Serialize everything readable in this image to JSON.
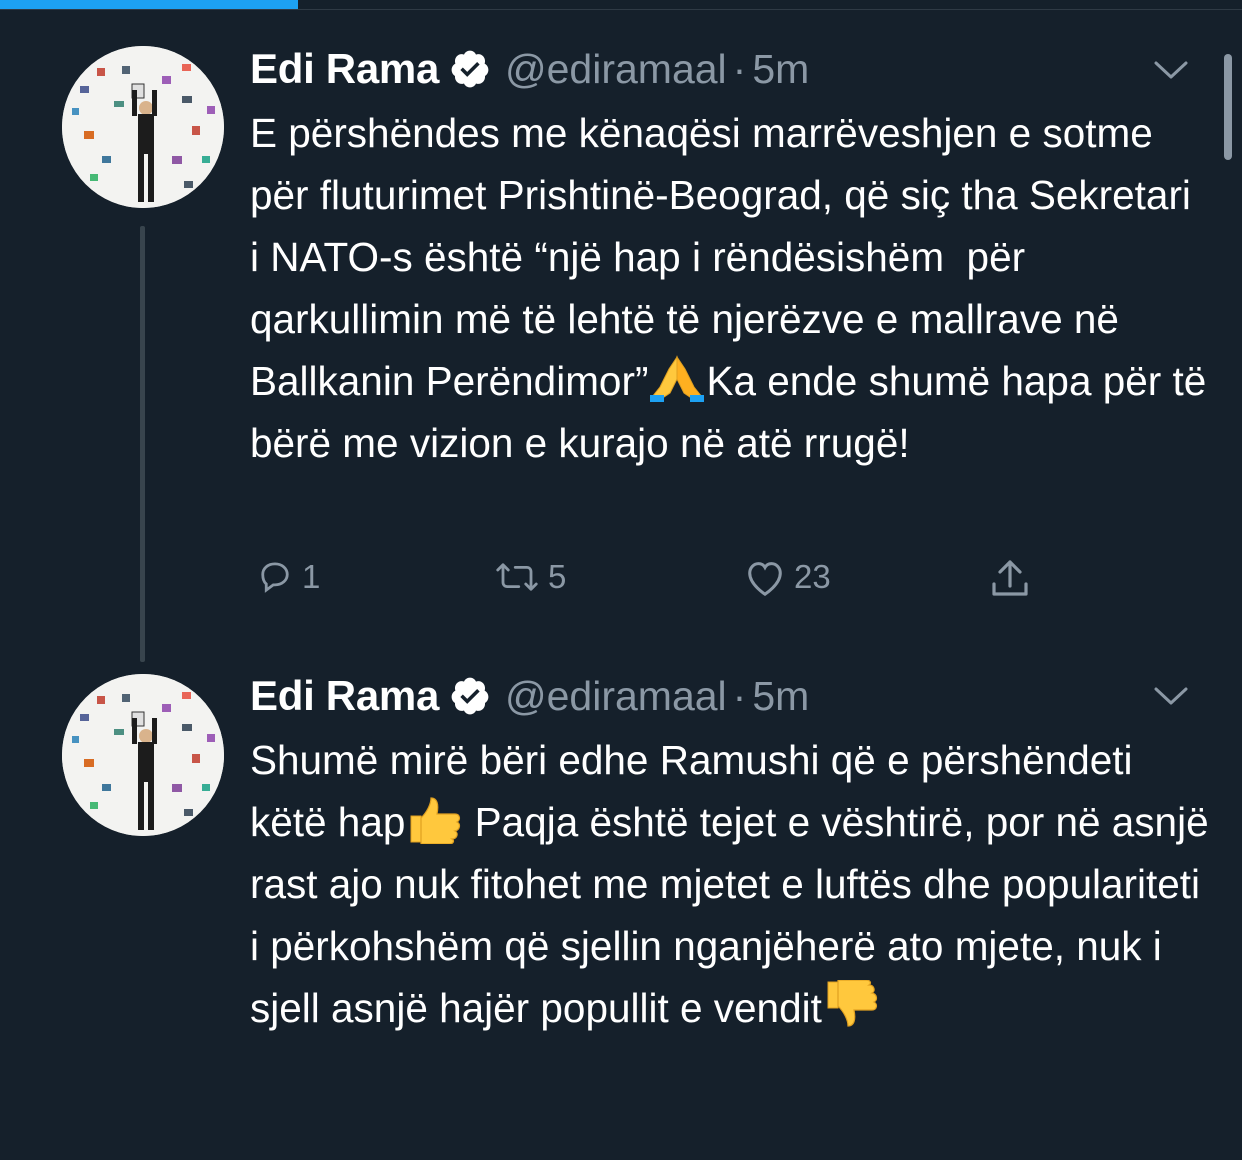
{
  "tweets": [
    {
      "name": "Edi Rama",
      "handle": "@ediramaal",
      "separator": "·",
      "time": "5m",
      "text_before_emoji": "E përshëndes me kënaqësi marrëveshjen e sotme për fluturimet Prishtinë-Beograd, që siç tha Sekretari i NATO-s është “një hap i rëndësishëm  për qarkullimin më të lehtë të njerëzve e mallrave në Ballkanin Perëndimor”",
      "text_after_emoji": "Ka ende shumë hapa për të bërë me vizion e kurajo në atë rrugë!",
      "emoji": "folded-hands",
      "reply_count": "1",
      "retweet_count": "5",
      "like_count": "23"
    },
    {
      "name": "Edi Rama",
      "handle": "@ediramaal",
      "separator": "·",
      "time": "5m",
      "text_before_emoji": "Shumë mirë bëri edhe Ramushi që e përshëndeti këtë hap",
      "emoji": "thumbs-up",
      "text_after_emoji": " Paqja është tejet e vështirë, por në asnjë rast ajo nuk fitohet me mjetet e luftës dhe populariteti i përkohshëm që sjellin nganjëherë ato mjete, nuk i sjell asnjë hajër popullit e vendit",
      "emoji_end": "thumbs-down"
    }
  ],
  "colors": {
    "background": "#15202b",
    "muted": "#8b98a5",
    "accent": "#1da1f2",
    "thread_line": "#38444d"
  },
  "loading_progress": 0.24
}
